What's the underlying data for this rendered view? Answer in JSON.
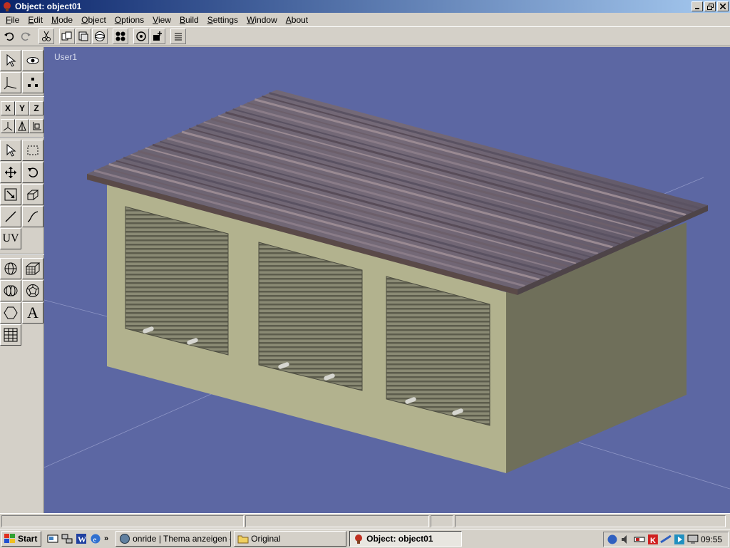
{
  "window": {
    "title": "Object: object01"
  },
  "menu": [
    {
      "label": "File",
      "accel": "F",
      "rest": "ile"
    },
    {
      "label": "Edit",
      "accel": "E",
      "rest": "dit"
    },
    {
      "label": "Mode",
      "accel": "M",
      "rest": "ode"
    },
    {
      "label": "Object",
      "accel": "O",
      "rest": "bject"
    },
    {
      "label": "Options",
      "accel": "O",
      "rest": "ptions"
    },
    {
      "label": "View",
      "accel": "V",
      "rest": "iew"
    },
    {
      "label": "Build",
      "accel": "B",
      "rest": "uild"
    },
    {
      "label": "Settings",
      "accel": "S",
      "rest": "ettings"
    },
    {
      "label": "Window",
      "accel": "W",
      "rest": "indow"
    },
    {
      "label": "About",
      "accel": "A",
      "rest": "bout"
    }
  ],
  "toolbar": [
    "undo-icon",
    "redo-icon",
    "cut-icon",
    "copy-object-icon",
    "paste-object-icon",
    "sphere-render-icon",
    "four-view-icon",
    "rotate-view-icon",
    "add-object-icon",
    "list-icon"
  ],
  "palette": {
    "axis_x": "X",
    "axis_y": "Y",
    "axis_z": "Z",
    "uv_label": "UV",
    "text_label": "A"
  },
  "viewport": {
    "label": "User1"
  },
  "taskbar": {
    "start": "Start",
    "tasks": [
      {
        "label": "onride | Thema anzeigen - ..."
      },
      {
        "label": "Original"
      },
      {
        "label": "Object: object01"
      }
    ],
    "clock": "09:55"
  },
  "colors": {
    "viewport_bg": "#5c67a3",
    "wall": "#b2b28e",
    "roof": "#6e6470",
    "title_gradient_start": "#0a246a"
  }
}
